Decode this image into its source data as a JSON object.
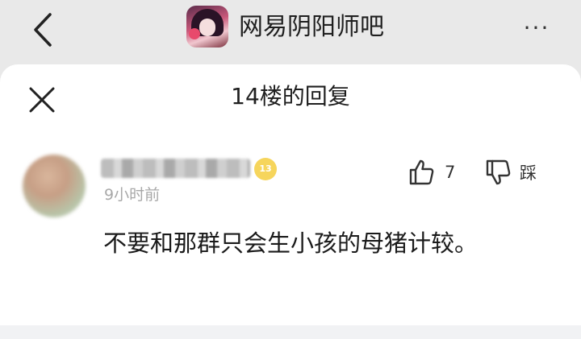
{
  "header": {
    "forum_name": "网易阴阳师吧",
    "more_label": "···"
  },
  "sheet": {
    "title": "14楼的回复"
  },
  "comment": {
    "level": "13",
    "timestamp": "9小时前",
    "like_count": "7",
    "dislike_label": "踩",
    "text": "不要和那群只会生小孩的母猪计较。"
  },
  "colors": {
    "header_bg": "#e9e9e9",
    "sheet_bg": "#ffffff",
    "level_badge": "#f6d55c",
    "meta_text": "#a8a8a8"
  }
}
